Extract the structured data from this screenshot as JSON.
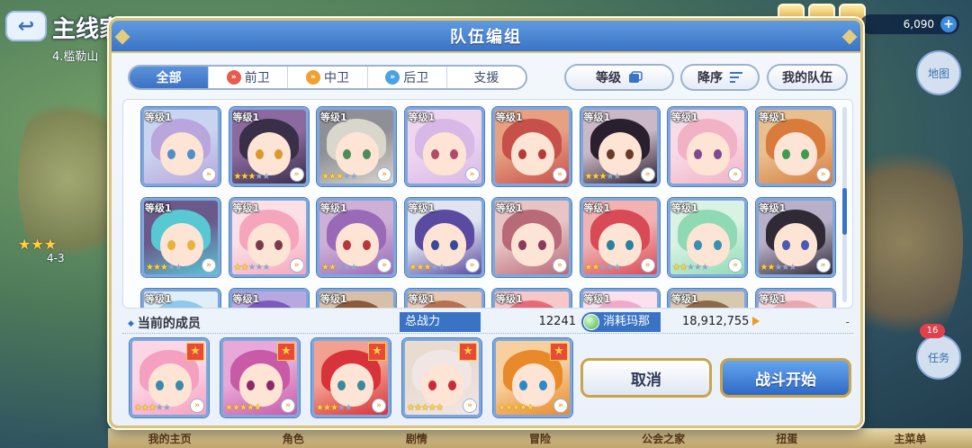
{
  "background": {
    "title": "主线家",
    "subtitle": "4.槛勒山",
    "currency": "6,090",
    "stage": "4-3",
    "side_buttons": [
      "地图",
      "任务"
    ],
    "side_badge": "16",
    "bottom_nav": [
      "我的主页",
      "角色",
      "剧情",
      "冒险",
      "公会之家",
      "扭蛋",
      "主菜单"
    ]
  },
  "dialog": {
    "title": "队伍编组",
    "filters": [
      {
        "label": "全部",
        "active": true
      },
      {
        "label": "前卫",
        "role": "front"
      },
      {
        "label": "中卫",
        "role": "mid"
      },
      {
        "label": "后卫",
        "role": "back"
      },
      {
        "label": "支援"
      }
    ],
    "sort_level": "等级",
    "sort_order": "降序",
    "my_team": "我的队伍"
  },
  "roster": {
    "level_label": "等级1",
    "cards": [
      {
        "hair": "#b9a6dc",
        "bg": "#c9d4f0",
        "eye": "#4f8fc9",
        "stars": 0
      },
      {
        "hair": "#3a2f48",
        "bg": "#8c6aa0",
        "eye": "#d99a2c",
        "stars": 3
      },
      {
        "hair": "#d9d6cc",
        "bg": "#8f8f96",
        "eye": "#4f8a5a",
        "stars": 3
      },
      {
        "hair": "#d8b8e6",
        "bg": "#efd6ef",
        "eye": "#b24a6a",
        "stars": 0
      },
      {
        "hair": "#c8504a",
        "bg": "#e7a082",
        "eye": "#b8393a",
        "stars": 0
      },
      {
        "hair": "#2a1f2e",
        "bg": "#cbb8c6",
        "eye": "#6a3a2a",
        "stars": 3
      },
      {
        "hair": "#f2b2c6",
        "bg": "#f7dbe6",
        "eye": "#7d4a90",
        "stars": 0
      },
      {
        "hair": "#d87b3c",
        "bg": "#e8c090",
        "eye": "#3f9a52",
        "stars": 0
      },
      {
        "hair": "#58c8d2",
        "bg": "#6a5a8c",
        "eye": "#e8b33a",
        "stars": 3
      },
      {
        "hair": "#f5a6bc",
        "bg": "#fbe0e8",
        "eye": "#7a3a4a",
        "stars": 2
      },
      {
        "hair": "#9a6ab8",
        "bg": "#cdb0d6",
        "eye": "#b5363e",
        "stars": 2
      },
      {
        "hair": "#5a4aa0",
        "bg": "#dfe4f0",
        "eye": "#3a4a9a",
        "stars": 3
      },
      {
        "hair": "#b86a78",
        "bg": "#e8c4c4",
        "eye": "#8a3a5a",
        "stars": 0
      },
      {
        "hair": "#d84a56",
        "bg": "#f2b2b2",
        "eye": "#2c7fa0",
        "stars": 2
      },
      {
        "hair": "#8fdab4",
        "bg": "#d9f2e4",
        "eye": "#3a8fb0",
        "stars": 2
      },
      {
        "hair": "#2f2a36",
        "bg": "#b8b0c8",
        "eye": "#4a5ab0",
        "stars": 2
      },
      {
        "hair": "#8fc8e8",
        "bg": "#dfeef8",
        "eye": "#3a6ab0",
        "stars": 0
      },
      {
        "hair": "#7a5ac0",
        "bg": "#b8a8e0",
        "eye": "#5a3a8a",
        "stars": 0
      },
      {
        "hair": "#8a5a3a",
        "bg": "#d8c0a8",
        "eye": "#5a3a2a",
        "stars": 0
      },
      {
        "hair": "#b87050",
        "bg": "#e8c8b0",
        "eye": "#6a3a2a",
        "stars": 0
      },
      {
        "hair": "#e86a78",
        "bg": "#f8c8c8",
        "eye": "#8a2a3a",
        "stars": 0
      },
      {
        "hair": "#f2a8c8",
        "bg": "#fbe0ee",
        "eye": "#7a3a6a",
        "stars": 0
      },
      {
        "hair": "#8a6a4a",
        "bg": "#d8c8b0",
        "eye": "#4a3a2a",
        "stars": 0
      },
      {
        "hair": "#e8a8b0",
        "bg": "#f8d8dc",
        "eye": "#8a4a5a",
        "stars": 0
      }
    ]
  },
  "members": {
    "label": "当前的成员",
    "power_label": "总战力",
    "power_value": "12241",
    "mana_label": "消耗玛那",
    "mana_value": "18,912,755",
    "dash": "-",
    "cards": [
      {
        "hair": "#f5a0c0",
        "bg": "#fbd6e6",
        "eye": "#3a8aa8",
        "stars": 3
      },
      {
        "hair": "#c85aa8",
        "bg": "#e8a8d8",
        "eye": "#8a2a6a",
        "stars": 5
      },
      {
        "hair": "#d8323a",
        "bg": "#f2a090",
        "eye": "#3a8a9a",
        "stars": 3
      },
      {
        "hair": "#f0e6e6",
        "bg": "#e8dcd0",
        "eye": "#c82a3a",
        "stars": 5
      },
      {
        "hair": "#e88a2a",
        "bg": "#f8d0a0",
        "eye": "#2a8ac8",
        "stars": 5
      }
    ]
  },
  "actions": {
    "cancel": "取消",
    "start": "战斗开始"
  }
}
